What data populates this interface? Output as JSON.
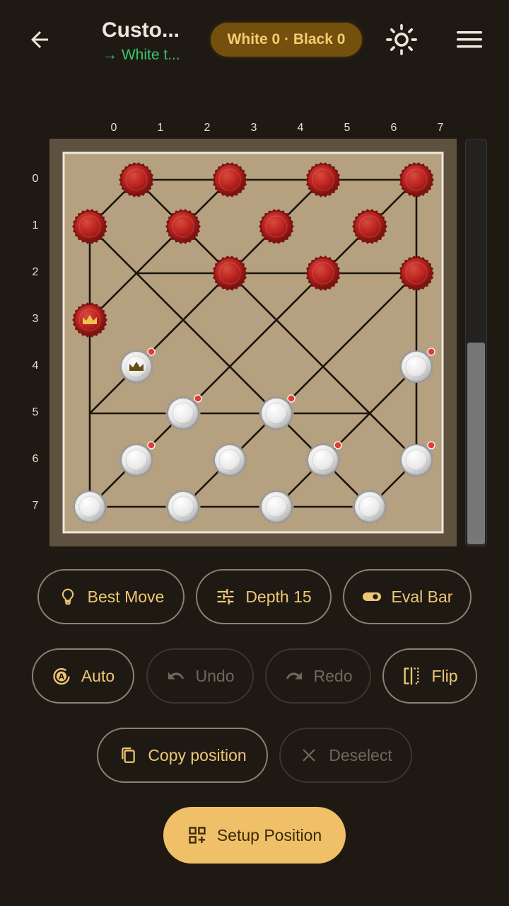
{
  "header": {
    "title": "Custo...",
    "subtitle": "→ White t...",
    "score": "White 0 · Black 0"
  },
  "board": {
    "col_labels": [
      "0",
      "1",
      "2",
      "3",
      "4",
      "5",
      "6",
      "7"
    ],
    "row_labels": [
      "0",
      "1",
      "2",
      "3",
      "4",
      "5",
      "6",
      "7"
    ],
    "pieces": [
      {
        "row": 0,
        "col": 1,
        "color": "red"
      },
      {
        "row": 0,
        "col": 3,
        "color": "red"
      },
      {
        "row": 0,
        "col": 5,
        "color": "red"
      },
      {
        "row": 0,
        "col": 7,
        "color": "red"
      },
      {
        "row": 1,
        "col": 0,
        "color": "red"
      },
      {
        "row": 1,
        "col": 2,
        "color": "red"
      },
      {
        "row": 1,
        "col": 4,
        "color": "red"
      },
      {
        "row": 1,
        "col": 6,
        "color": "red"
      },
      {
        "row": 2,
        "col": 3,
        "color": "red"
      },
      {
        "row": 2,
        "col": 5,
        "color": "red"
      },
      {
        "row": 2,
        "col": 7,
        "color": "red"
      },
      {
        "row": 3,
        "col": 0,
        "color": "red",
        "king": true
      },
      {
        "row": 4,
        "col": 1,
        "color": "white",
        "king": true,
        "movable": true
      },
      {
        "row": 4,
        "col": 7,
        "color": "white",
        "movable": true
      },
      {
        "row": 5,
        "col": 2,
        "color": "white",
        "movable": true
      },
      {
        "row": 5,
        "col": 4,
        "color": "white",
        "movable": true
      },
      {
        "row": 6,
        "col": 1,
        "color": "white",
        "movable": true
      },
      {
        "row": 6,
        "col": 3,
        "color": "white"
      },
      {
        "row": 6,
        "col": 5,
        "color": "white",
        "movable": true
      },
      {
        "row": 6,
        "col": 7,
        "color": "white",
        "movable": true
      },
      {
        "row": 7,
        "col": 0,
        "color": "white"
      },
      {
        "row": 7,
        "col": 2,
        "color": "white"
      },
      {
        "row": 7,
        "col": 4,
        "color": "white"
      },
      {
        "row": 7,
        "col": 6,
        "color": "white"
      }
    ],
    "eval_white_fraction": 0.5
  },
  "controls": {
    "best_move": "Best Move",
    "depth": "Depth 15",
    "eval_bar": "Eval Bar",
    "auto": "Auto",
    "undo": "Undo",
    "redo": "Redo",
    "flip": "Flip",
    "copy_position": "Copy position",
    "deselect": "Deselect",
    "setup_position": "Setup Position"
  },
  "colors": {
    "accent": "#efc067",
    "turn_indicator": "#39c56b",
    "red_piece": "#b8201c",
    "board_surface": "#b5a080"
  },
  "icons": {
    "back": "arrow-left-icon",
    "theme": "sun-icon",
    "menu": "hamburger-icon",
    "best_move": "lightbulb-icon",
    "depth": "sliders-icon",
    "eval_bar": "toggle-icon",
    "auto": "auto-play-icon",
    "undo": "undo-icon",
    "redo": "redo-icon",
    "flip": "flip-icon",
    "copy": "copy-icon",
    "deselect": "close-icon",
    "setup": "add-grid-icon"
  }
}
